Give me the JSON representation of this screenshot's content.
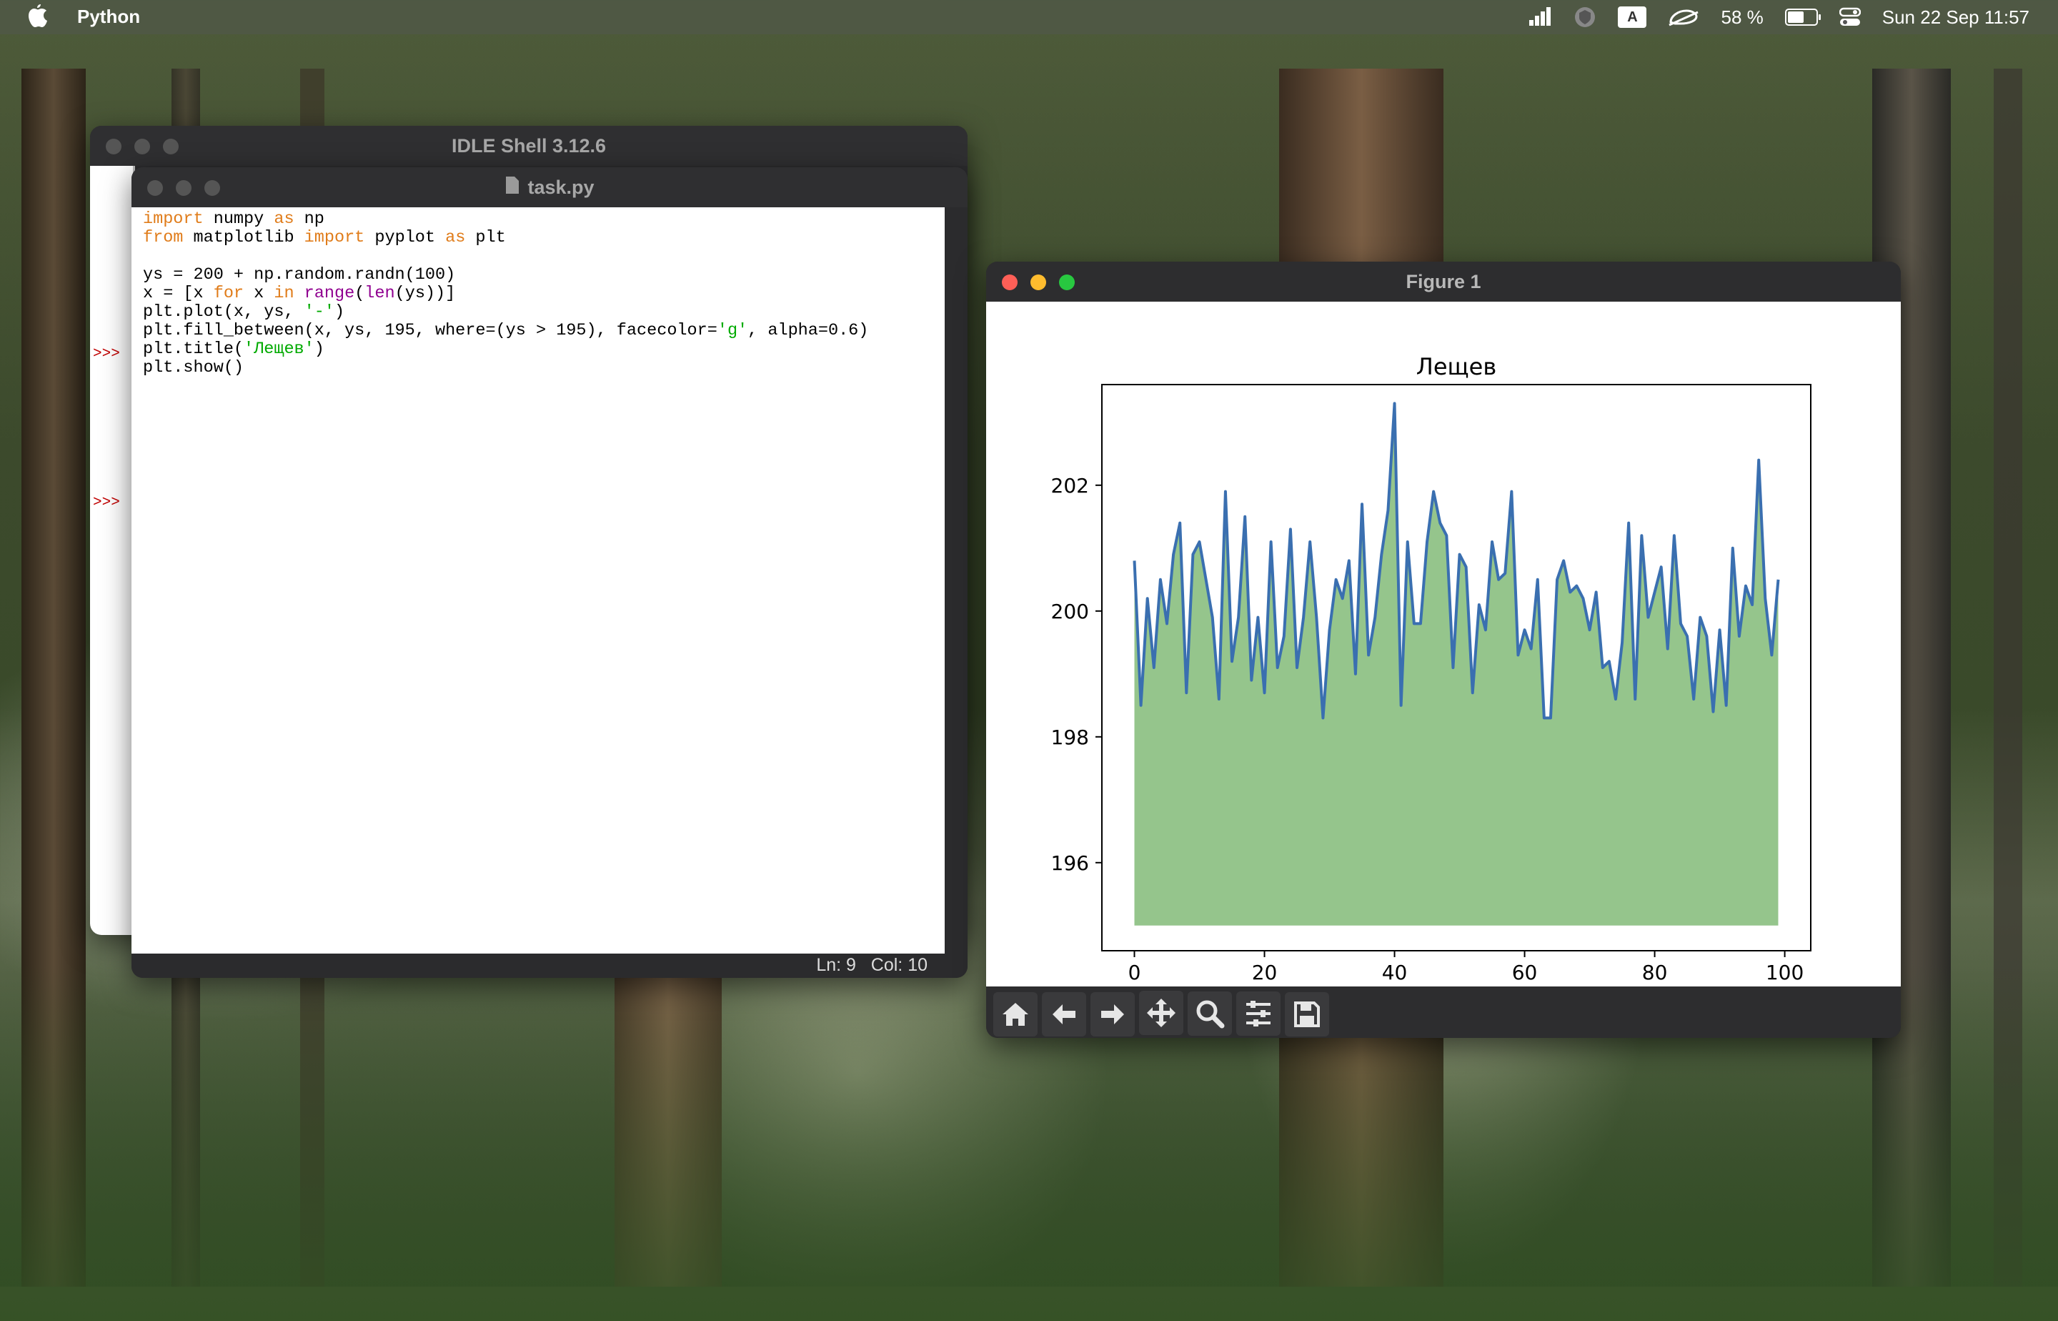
{
  "menubar": {
    "app_name": "Python",
    "battery_text": "58 %",
    "battery_fraction": 0.58,
    "keyboard_layout": "A",
    "clock": "Sun 22 Sep  11:57"
  },
  "idle_shell": {
    "title": "IDLE Shell 3.12.6",
    "prompts": [
      ">>>",
      ">>>"
    ]
  },
  "editor": {
    "title": "task.py",
    "lines": [
      [
        {
          "t": "import",
          "c": "kw"
        },
        {
          "t": " numpy ",
          "c": ""
        },
        {
          "t": "as",
          "c": "kw"
        },
        {
          "t": " np",
          "c": ""
        }
      ],
      [
        {
          "t": "from",
          "c": "kw"
        },
        {
          "t": " matplotlib ",
          "c": ""
        },
        {
          "t": "import",
          "c": "kw"
        },
        {
          "t": " pyplot ",
          "c": ""
        },
        {
          "t": "as",
          "c": "kw"
        },
        {
          "t": " plt",
          "c": ""
        }
      ],
      [],
      [
        {
          "t": "ys = 200 + np.random.randn(100)",
          "c": ""
        }
      ],
      [
        {
          "t": "x = [x ",
          "c": ""
        },
        {
          "t": "for",
          "c": "kw"
        },
        {
          "t": " x ",
          "c": ""
        },
        {
          "t": "in",
          "c": "kw"
        },
        {
          "t": " ",
          "c": ""
        },
        {
          "t": "range",
          "c": "bi"
        },
        {
          "t": "(",
          "c": ""
        },
        {
          "t": "len",
          "c": "bi"
        },
        {
          "t": "(ys))]",
          "c": ""
        }
      ],
      [
        {
          "t": "plt.plot(x, ys, ",
          "c": ""
        },
        {
          "t": "'-'",
          "c": "str"
        },
        {
          "t": ")",
          "c": ""
        }
      ],
      [
        {
          "t": "plt.fill_between(x, ys, 195, where=(ys > 195), facecolor=",
          "c": ""
        },
        {
          "t": "'g'",
          "c": "str"
        },
        {
          "t": ", alpha=0.6)",
          "c": ""
        }
      ],
      [
        {
          "t": "plt.title(",
          "c": ""
        },
        {
          "t": "'Лещев'",
          "c": "str"
        },
        {
          "t": ")",
          "c": ""
        }
      ],
      [
        {
          "t": "plt.show()",
          "c": ""
        }
      ]
    ],
    "status": "Ln: 9   Col: 10"
  },
  "figure": {
    "title": "Figure 1",
    "toolbar": [
      {
        "name": "home-button",
        "icon": "home-icon"
      },
      {
        "name": "back-button",
        "icon": "arrow-left-icon"
      },
      {
        "name": "forward-button",
        "icon": "arrow-right-icon"
      },
      {
        "name": "pan-button",
        "icon": "move-icon"
      },
      {
        "name": "zoom-button",
        "icon": "magnifier-icon"
      },
      {
        "name": "configure-subplots-button",
        "icon": "sliders-icon"
      },
      {
        "name": "save-button",
        "icon": "floppy-disk-icon"
      }
    ]
  },
  "chart_data": {
    "type": "area",
    "title": "Лещев",
    "xlabel": "",
    "ylabel": "",
    "xlim": [
      -5,
      104
    ],
    "ylim": [
      194.6,
      203.6
    ],
    "xticks": [
      0,
      20,
      40,
      60,
      80,
      100
    ],
    "yticks": [
      196,
      198,
      200,
      202
    ],
    "fill_baseline": 195,
    "line_color": "#3a6fb0",
    "fill_color": "#4e9e3f",
    "fill_alpha": 0.6,
    "grid": false,
    "x": [
      0,
      1,
      2,
      3,
      4,
      5,
      6,
      7,
      8,
      9,
      10,
      11,
      12,
      13,
      14,
      15,
      16,
      17,
      18,
      19,
      20,
      21,
      22,
      23,
      24,
      25,
      26,
      27,
      28,
      29,
      30,
      31,
      32,
      33,
      34,
      35,
      36,
      37,
      38,
      39,
      40,
      41,
      42,
      43,
      44,
      45,
      46,
      47,
      48,
      49,
      50,
      51,
      52,
      53,
      54,
      55,
      56,
      57,
      58,
      59,
      60,
      61,
      62,
      63,
      64,
      65,
      66,
      67,
      68,
      69,
      70,
      71,
      72,
      73,
      74,
      75,
      76,
      77,
      78,
      79,
      80,
      81,
      82,
      83,
      84,
      85,
      86,
      87,
      88,
      89,
      90,
      91,
      92,
      93,
      94,
      95,
      96,
      97,
      98,
      99
    ],
    "y": [
      200.8,
      198.5,
      200.2,
      199.1,
      200.5,
      199.8,
      200.9,
      201.4,
      198.7,
      200.9,
      201.1,
      200.5,
      199.9,
      198.6,
      201.9,
      199.2,
      199.9,
      201.5,
      198.9,
      199.9,
      198.7,
      201.1,
      199.1,
      199.6,
      201.3,
      199.1,
      199.9,
      201.1,
      199.9,
      198.3,
      199.7,
      200.5,
      200.2,
      200.8,
      199.0,
      201.7,
      199.3,
      199.9,
      200.9,
      201.6,
      203.3,
      198.5,
      201.1,
      199.8,
      199.8,
      201.1,
      201.9,
      201.4,
      201.2,
      199.1,
      200.9,
      200.7,
      198.7,
      200.1,
      199.7,
      201.1,
      200.5,
      200.6,
      201.9,
      199.3,
      199.7,
      199.4,
      200.5,
      198.3,
      198.3,
      200.5,
      200.8,
      200.3,
      200.4,
      200.2,
      199.7,
      200.3,
      199.1,
      199.2,
      198.6,
      199.5,
      201.4,
      198.6,
      201.2,
      199.9,
      200.3,
      200.7,
      199.4,
      201.2,
      199.8,
      199.6,
      198.6,
      199.9,
      199.6,
      198.4,
      199.7,
      198.5,
      201.0,
      199.6,
      200.4,
      200.1,
      202.4,
      200.2,
      199.3,
      200.5
    ]
  }
}
